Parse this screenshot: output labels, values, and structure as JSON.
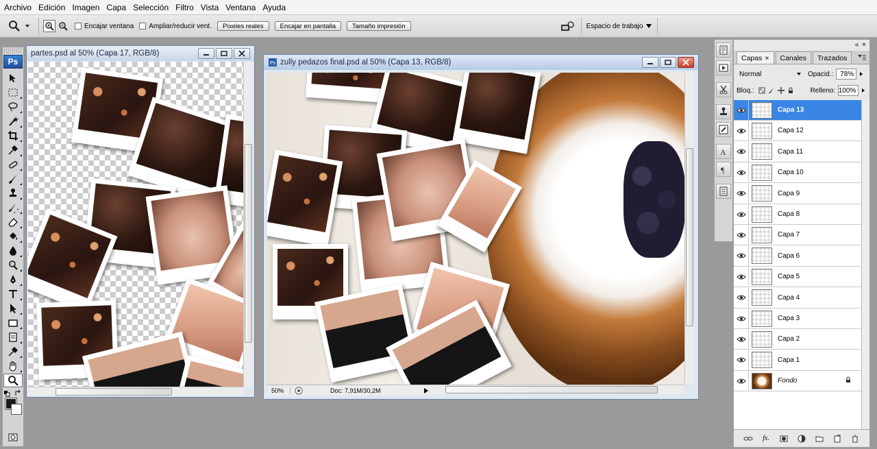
{
  "menu": [
    "Archivo",
    "Edición",
    "Imagen",
    "Capa",
    "Selección",
    "Filtro",
    "Vista",
    "Ventana",
    "Ayuda"
  ],
  "options": {
    "zoom_tool_icon": "magnifier-icon",
    "checkbox_fit_window": "Encajar ventana",
    "checkbox_resize": "Ampliar/reducir vent.",
    "btn_actual_pixels": "Píxeles reales",
    "btn_fit_screen": "Encajar en pantalla",
    "btn_print_size": "Tamaño impresión",
    "workspace": "Espacio de trabajo"
  },
  "doc_left": {
    "title": "partes.psd al 50% (Capa 17, RGB/8)"
  },
  "doc_main": {
    "title": "zully pedazos final.psd al 50% (Capa 13, RGB/8)",
    "zoom": "50%",
    "doc_info": "Doc: 7,91M/30,2M"
  },
  "layers_panel": {
    "tabs": [
      "Capas",
      "Canales",
      "Trazados"
    ],
    "blend_mode": "Normal",
    "opacity_label": "Opacid.:",
    "opacity": "78%",
    "lock_label": "Bloq.:",
    "fill_label": "Relleno:",
    "fill": "100%",
    "layers": [
      {
        "name": "Capa 13",
        "selected": true
      },
      {
        "name": "Capa 12"
      },
      {
        "name": "Capa 11"
      },
      {
        "name": "Capa 10"
      },
      {
        "name": "Capa 9"
      },
      {
        "name": "Capa 8"
      },
      {
        "name": "Capa 7"
      },
      {
        "name": "Capa 6"
      },
      {
        "name": "Capa 5"
      },
      {
        "name": "Capa 4"
      },
      {
        "name": "Capa 3"
      },
      {
        "name": "Capa 2"
      },
      {
        "name": "Capa 1"
      },
      {
        "name": "Fondo",
        "locked": true
      }
    ]
  },
  "colors": {
    "accent": "#3a86e6",
    "foreground": "#1a1a1a",
    "background": "#ffffff"
  }
}
